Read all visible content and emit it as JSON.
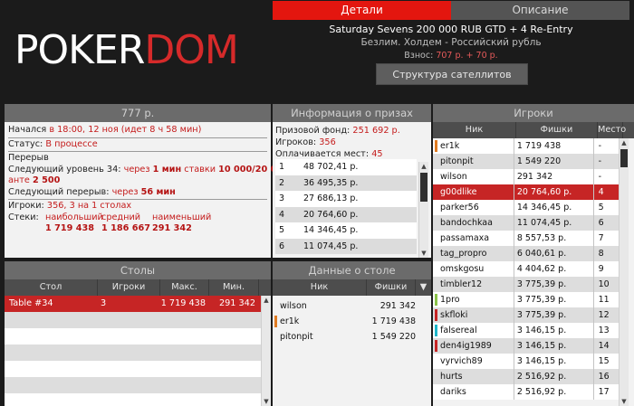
{
  "logo": {
    "part1": "POKER",
    "part2": "DOM"
  },
  "tabs": [
    "Детали",
    "Описание"
  ],
  "tournament": {
    "title": "Saturday Sevens 200 000 RUB GTD + 4 Re-Entry",
    "subtitle": "Безлим. Холдем - Российский рубль",
    "fee_label": "Взнос:",
    "fee_value": "707 р. + 70 р.",
    "satellites_button": "Структура сателлитов"
  },
  "info": {
    "title": "777 р.",
    "started_label": "Начался",
    "started_value": "в 18:00, 12 ноя (идет 8 ч 58 мин)",
    "status_label": "Статус:",
    "status_value": "В процессе",
    "break_text": "Перерыв",
    "next_level_label": "Следующий уровень 34:",
    "next_level_in": "через",
    "next_level_time": "1 мин",
    "stakes_label": "ставки",
    "stakes_value": "10 000/20 000",
    "ante_label": "анте",
    "ante_value": "2 500",
    "next_break_label": "Следующий перерыв:",
    "next_break_in": "через",
    "next_break_time": "56 мин",
    "players_label": "Игроки:",
    "players_value": "356, 3 на 1 столах",
    "stacks_label": "Стеки:",
    "stacks_headers": [
      "наибольший",
      "средний",
      "наименьший"
    ],
    "stacks_values": [
      "1 719 438",
      "1 186 667",
      "291 342"
    ]
  },
  "prize": {
    "title": "Информация о призах",
    "fund_label": "Призовой фонд:",
    "fund_value": "251 692 р.",
    "players_label": "Игроков:",
    "players_value": "356",
    "paid_label": "Оплачивается мест:",
    "paid_value": "45",
    "rows": [
      [
        "1",
        "48 702,41 р."
      ],
      [
        "2",
        "36 495,35 р."
      ],
      [
        "3",
        "27 686,13 р."
      ],
      [
        "4",
        "20 764,60 р."
      ],
      [
        "5",
        "14 346,45 р."
      ],
      [
        "6",
        "11 074,45 р."
      ]
    ]
  },
  "tables": {
    "title": "Столы",
    "headers": [
      "Стол",
      "Игроки",
      "Макс.",
      "Мин."
    ],
    "rows": [
      [
        "Table #34",
        "3",
        "1 719 438",
        "291 342"
      ]
    ]
  },
  "table_data": {
    "title": "Данные о столе",
    "headers": [
      "Ник",
      "Фишки"
    ],
    "rows": [
      {
        "nick": "wilson",
        "chips": "291 342",
        "mark": ""
      },
      {
        "nick": "er1k",
        "chips": "1 719 438",
        "mark": "#e07b22"
      },
      {
        "nick": "pitonpit",
        "chips": "1 549 220",
        "mark": ""
      }
    ]
  },
  "players": {
    "title": "Игроки",
    "headers": [
      "Ник",
      "Фишки",
      "Место"
    ],
    "rows": [
      {
        "nick": "er1k",
        "chips": "1 719 438",
        "place": "-",
        "mark": "#e07b22"
      },
      {
        "nick": "pitonpit",
        "chips": "1 549 220",
        "place": "-",
        "mark": ""
      },
      {
        "nick": "wilson",
        "chips": "291 342",
        "place": "-",
        "mark": ""
      },
      {
        "nick": "g00dlike",
        "chips": "20 764,60 р.",
        "place": "4",
        "mark": ""
      },
      {
        "nick": "parker56",
        "chips": "14 346,45 р.",
        "place": "5",
        "mark": ""
      },
      {
        "nick": "bandochkaa",
        "chips": "11 074,45 р.",
        "place": "6",
        "mark": ""
      },
      {
        "nick": "passamaxa",
        "chips": "8 557,53 р.",
        "place": "7",
        "mark": ""
      },
      {
        "nick": "tag_propro",
        "chips": "6 040,61 р.",
        "place": "8",
        "mark": ""
      },
      {
        "nick": "omskgosu",
        "chips": "4 404,62 р.",
        "place": "9",
        "mark": ""
      },
      {
        "nick": "timbler12",
        "chips": "3 775,39 р.",
        "place": "10",
        "mark": ""
      },
      {
        "nick": "1pro",
        "chips": "3 775,39 р.",
        "place": "11",
        "mark": "#8bc34a"
      },
      {
        "nick": "skfloki",
        "chips": "3 775,39 р.",
        "place": "12",
        "mark": "#c62525"
      },
      {
        "nick": "falsereal",
        "chips": "3 146,15 р.",
        "place": "13",
        "mark": "#1fb6c9"
      },
      {
        "nick": "den4ig1989",
        "chips": "3 146,15 р.",
        "place": "14",
        "mark": "#c62525"
      },
      {
        "nick": "vyrvich89",
        "chips": "3 146,15 р.",
        "place": "15",
        "mark": ""
      },
      {
        "nick": "hurts",
        "chips": "2 516,92 р.",
        "place": "16",
        "mark": ""
      },
      {
        "nick": "dariks",
        "chips": "2 516,92 р.",
        "place": "17",
        "mark": ""
      }
    ],
    "selected_index": 3
  }
}
